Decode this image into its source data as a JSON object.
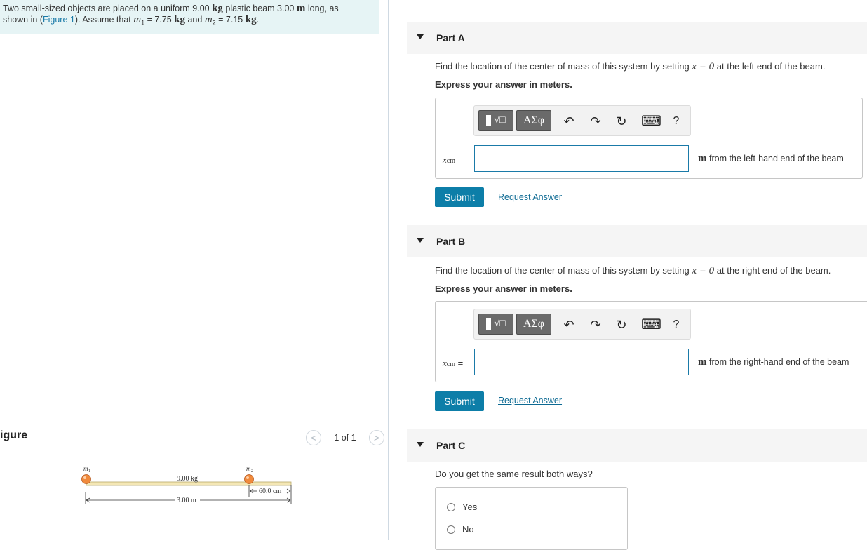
{
  "intro": {
    "text1": "Two small-sized objects are placed on a uniform 9.00",
    "unit_kg": "kg",
    "text2": "plastic beam 3.00",
    "unit_m": "m",
    "text3": "long, as",
    "text4": "shown in (",
    "figure_link": "Figure 1",
    "text5": "). Assume that",
    "m1_sym": "m",
    "m1_sub": "1",
    "m1_val": " = 7.75",
    "unit_kg2": "kg",
    "and": "and",
    "m2_sym": "m",
    "m2_sub": "2",
    "m2_val": " = 7.15",
    "unit_kg3": "kg",
    "period": "."
  },
  "figure": {
    "title": "igure",
    "counter": "1 of 1",
    "prev_icon": "<",
    "next_icon": ">",
    "m1_label": "m",
    "m1_sub": "1",
    "m2_label": "m",
    "m2_sub": "2",
    "beam_mass": "9.00 kg",
    "beam_length": "3.00 m",
    "offset": "60.0 cm"
  },
  "parts": [
    {
      "title": "Part A",
      "question_pre": "Find the location of the center of mass of this system by setting",
      "math": "x = 0",
      "question_post": "at the left end of the beam.",
      "instruction": "Express your answer in meters.",
      "var_symbol": "x",
      "var_sub": "cm",
      "equals": "=",
      "input_value": "",
      "unit_symbol": "m",
      "unit_text": "from the left-hand end of the beam",
      "submit": "Submit",
      "request": "Request Answer"
    },
    {
      "title": "Part B",
      "question_pre": "Find the location of the center of mass of this system by setting",
      "math": "x = 0",
      "question_post": "at the right end of the beam.",
      "instruction": "Express your answer in meters.",
      "var_symbol": "x",
      "var_sub": "cm",
      "equals": "=",
      "input_value": "",
      "unit_symbol": "m",
      "unit_text": "from the right-hand end of the beam",
      "submit": "Submit",
      "request": "Request Answer"
    },
    {
      "title": "Part C",
      "question": "Do you get the same result both ways?",
      "options": [
        "Yes",
        "No"
      ]
    }
  ],
  "toolbar": {
    "template_label": "√□",
    "greek_label": "ΑΣφ",
    "undo_icon": "↶",
    "redo_icon": "↷",
    "reset_icon": "↻",
    "keyboard_icon": "⌨",
    "help_label": "?"
  },
  "colors": {
    "accent": "#0d7ea8",
    "intro_bg": "#e6f4f5",
    "ball": "#f08a3c"
  }
}
